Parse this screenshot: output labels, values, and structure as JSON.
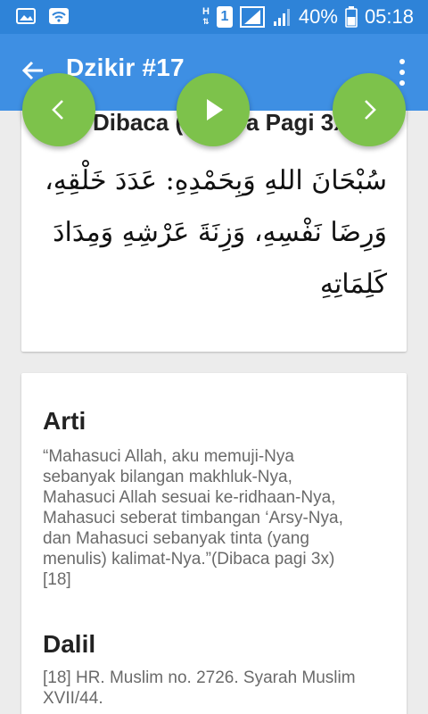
{
  "status_bar": {
    "battery": "40%",
    "time": "05:18",
    "sim_slot": "1",
    "network_type": "H",
    "icons": [
      "image-icon",
      "wifi-icon",
      "signal-h-icon",
      "sim1-icon",
      "signal-bars-icon",
      "signal-bars-2-icon",
      "battery-icon"
    ]
  },
  "app_bar": {
    "title": "Dzikir #17",
    "back_icon": "arrow-back-icon",
    "menu_icon": "more-vert-icon"
  },
  "media_controls": {
    "prev_icon": "chevron-left-icon",
    "play_icon": "play-icon",
    "next_icon": "chevron-right-icon",
    "color": "#7dc24b"
  },
  "dzikir_card": {
    "read_title": "Dibaca (Dibaca Pagi 3x)",
    "arabic_text": "سُبْحَانَ اللهِ وَبِحَمْدِهِ: عَدَدَ خَلْقِهِ، وَرِضَا نَفْسِهِ، وَزِنَةَ عَرْشِهِ وَمِدَادَ كَلِمَاتِهِ"
  },
  "arti": {
    "heading": "Arti",
    "text": "“Mahasuci Allah, aku memuji-Nya sebanyak bilangan makhluk-Nya, Mahasuci Allah sesuai ke-ridhaan-Nya, Mahasuci seberat timbangan ‘Arsy-Nya, dan Mahasuci sebanyak tinta (yang menulis) kalimat-Nya.”(Dibaca pagi 3x) [18]"
  },
  "dalil": {
    "heading": "Dalil",
    "text": "[18] HR. Muslim no. 2726. Syarah Muslim XVII/44."
  },
  "colors": {
    "status_bar": "#2e83d8",
    "app_bar": "#3e8fe3",
    "background": "#ececec",
    "fab": "#7dc24b"
  }
}
